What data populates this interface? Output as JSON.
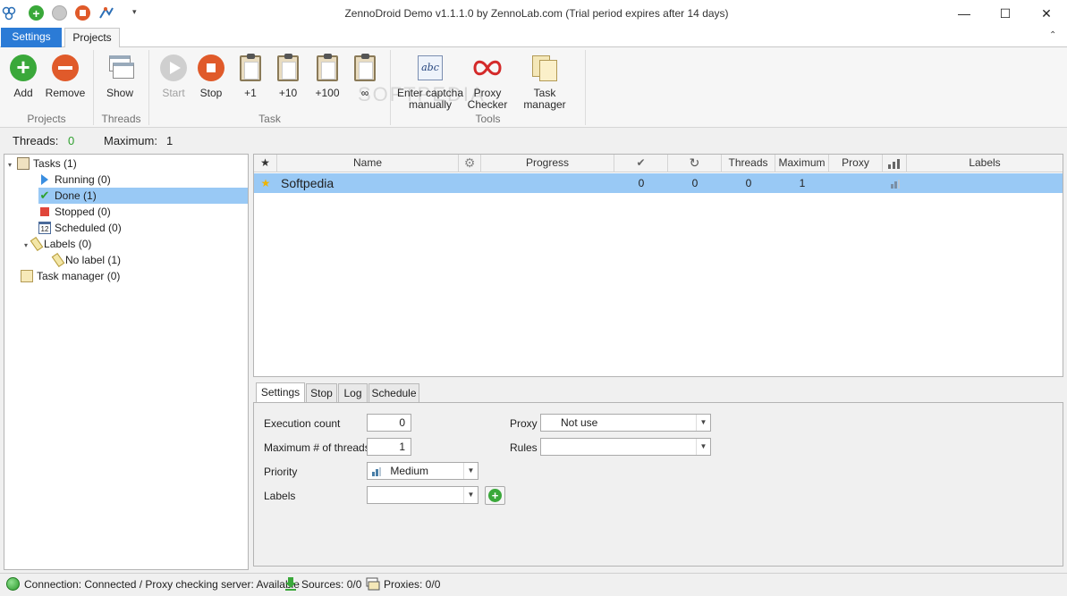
{
  "window": {
    "title": "ZennoDroid Demo v1.1.1.0 by ZennoLab.com (Trial period expires after 14 days)",
    "minimize": "—",
    "maximize": "☐",
    "close": "✕"
  },
  "tabs": [
    {
      "label": "Settings"
    },
    {
      "label": "Projects"
    }
  ],
  "ribbon": {
    "groups": [
      "Projects",
      "Threads",
      "Task",
      "Tools"
    ],
    "buttons": {
      "add": "Add",
      "remove": "Remove",
      "show": "Show",
      "start": "Start",
      "stop": "Stop",
      "plus1": "+1",
      "plus10": "+10",
      "plus100": "+100",
      "infinite": "∞",
      "captcha1": "Enter captcha",
      "captcha2": "manually",
      "proxy1": "Proxy",
      "proxy2": "Checker",
      "taskmanager": "Task manager"
    },
    "watermark": "SOFTPEDIA"
  },
  "threads": {
    "label": "Threads:",
    "value": "0",
    "max_label": "Maximum:",
    "max_value": "1"
  },
  "tree": {
    "tasks": "Tasks (1)",
    "running": "Running (0)",
    "done": "Done (1)",
    "stopped": "Stopped (0)",
    "scheduled": "Scheduled (0)",
    "labels": "Labels (0)",
    "nolabel": "No label (1)",
    "taskmanager": "Task manager (0)",
    "scheduled_day": "12"
  },
  "grid": {
    "headers": {
      "name": "Name",
      "progress": "Progress",
      "done": "✔",
      "repeat": "↻",
      "threads": "Threads",
      "maximum": "Maximum",
      "proxy": "Proxy",
      "labels": "Labels"
    },
    "row": {
      "name": "Softpedia",
      "done": "0",
      "repeat": "0",
      "threads": "0",
      "maximum": "1"
    }
  },
  "bottom_tabs": [
    {
      "label": "Settings"
    },
    {
      "label": "Stop"
    },
    {
      "label": "Log"
    },
    {
      "label": "Schedule"
    }
  ],
  "settings_form": {
    "execution_count_label": "Execution count",
    "execution_count": "0",
    "max_threads_label": "Maximum # of threads",
    "max_threads": "1",
    "priority_label": "Priority",
    "priority": "Medium",
    "labels_label": "Labels",
    "labels_value": "",
    "proxy_label": "Proxy",
    "proxy": "Not use",
    "rules_label": "Rules",
    "rules": ""
  },
  "status": {
    "connection": "Connection: Connected / Proxy checking server: Available",
    "sources": "Sources: 0/0",
    "proxies": "Proxies: 0/0"
  },
  "colors": {
    "accent": "#2b7bd6",
    "selection": "#99c9f5",
    "green": "#3aa83a",
    "red": "#e05a2a"
  }
}
